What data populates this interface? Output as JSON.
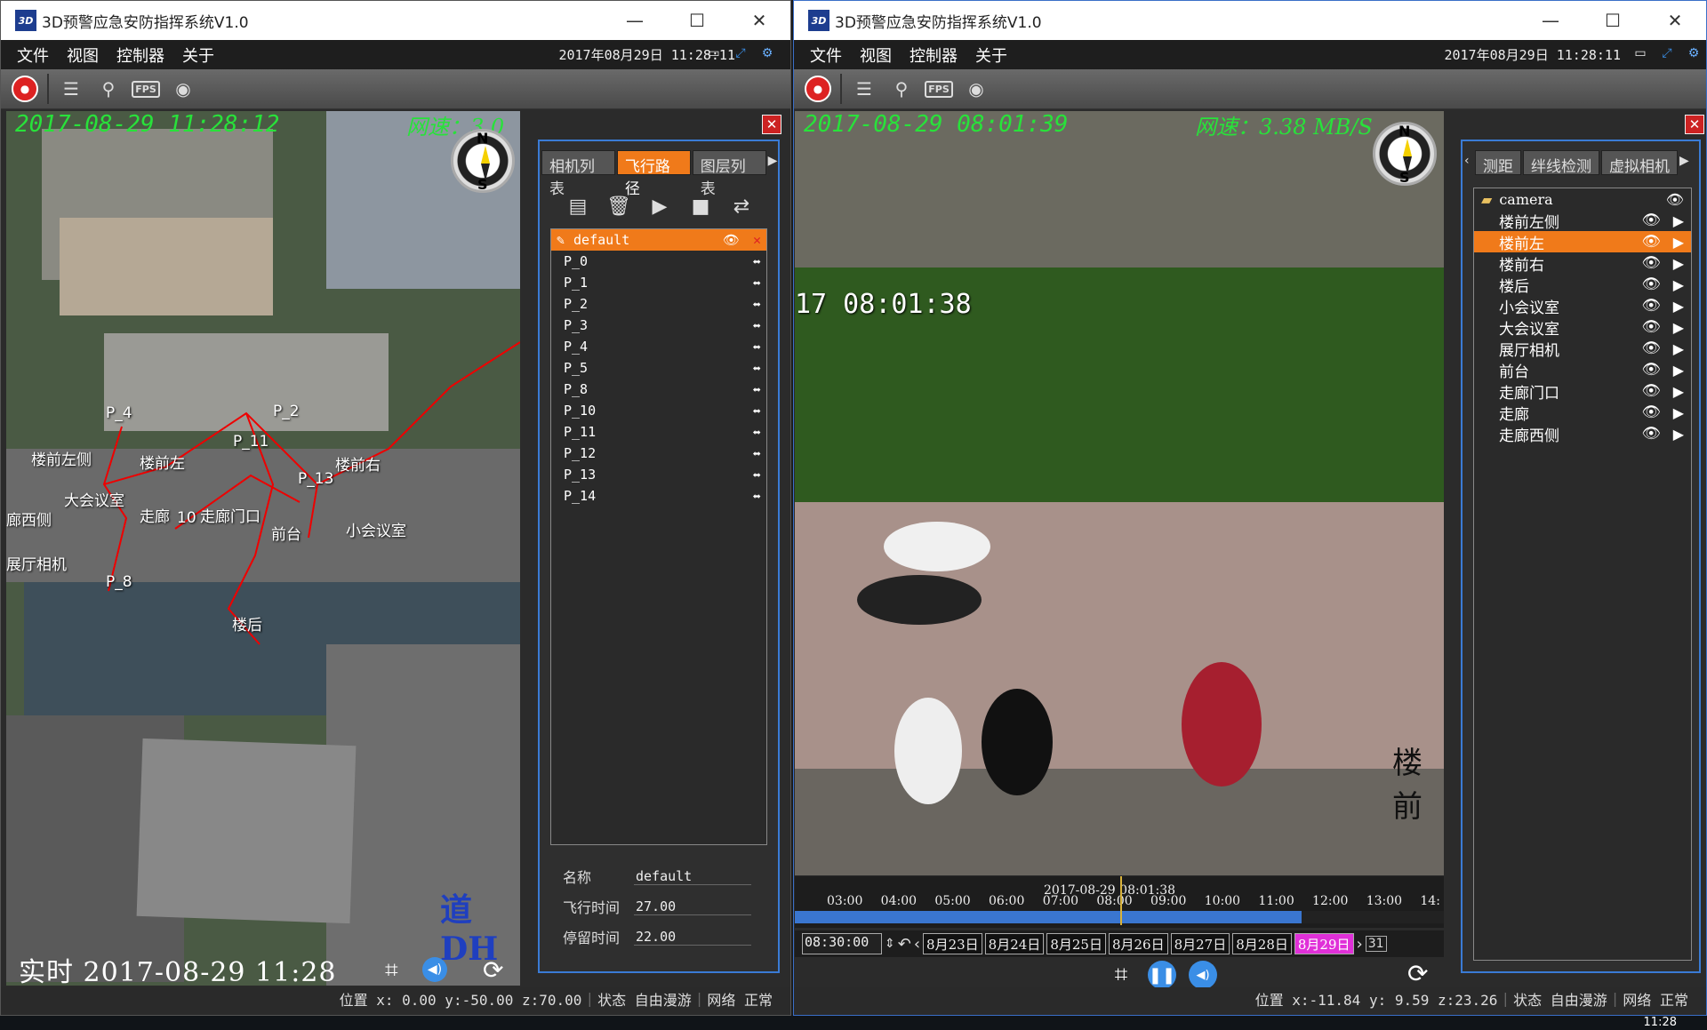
{
  "left_window": {
    "title": "3D预警应急安防指挥系统V1.0",
    "logo_text": "3D",
    "window_controls": {
      "minimize": "—",
      "maximize": "☐",
      "close": "✕"
    },
    "menu": [
      "文件",
      "视图",
      "控制器",
      "关于"
    ],
    "datetime": "2017年08月29日 11:28:11",
    "overlay_time": "2017-08-29 11:28:12",
    "overlay_speed": "网速：3.0",
    "compass": {
      "north": "N",
      "south": "S"
    },
    "map_labels": {
      "p4": "P_4",
      "p2": "P_2",
      "p11": "P_11",
      "p13": "P_13",
      "p8": "P_8",
      "p10": "10",
      "loqian_zuoce": "楼前左侧",
      "loqian_zuo": "楼前左",
      "loqian_you": "楼前右",
      "dahui": "大会议室",
      "zoulang": "走廊",
      "zoulang_menkou": "走廊门口",
      "qiantai": "前台",
      "xiaohui": "小会议室",
      "zhanting": "展厅相机",
      "langxi": "廊西侧",
      "louhou": "楼后"
    },
    "logo_watermark": "道DH",
    "bottom_overlay": "实时  2017-08-29 11:28",
    "tabs": [
      "相机列表",
      "飞行路径",
      "图层列表"
    ],
    "active_tab": "飞行路径",
    "path_list": {
      "selected": "default",
      "items": [
        "P_0",
        "P_1",
        "P_2",
        "P_3",
        "P_4",
        "P_5",
        "P_8",
        "P_10",
        "P_11",
        "P_12",
        "P_13",
        "P_14"
      ]
    },
    "props": [
      {
        "key": "名称",
        "value": "default"
      },
      {
        "key": "飞行时间",
        "value": "27.00"
      },
      {
        "key": "停留时间",
        "value": "22.00"
      }
    ],
    "status": {
      "position": "位置 x: 0.00 y:-50.00 z:70.00",
      "state": "状态  自由漫游",
      "network": "网络  正常"
    }
  },
  "right_window": {
    "title": "3D预警应急安防指挥系统V1.0",
    "logo_text": "3D",
    "window_controls": {
      "minimize": "—",
      "maximize": "☐",
      "close": "✕"
    },
    "menu": [
      "文件",
      "视图",
      "控制器",
      "关于"
    ],
    "datetime": "2017年08月29日 11:28:11",
    "overlay_time": "2017-08-29 08:01:39",
    "overlay_speed": "网速：3.38 MB/S",
    "compass": {
      "north": "N",
      "south": "S"
    },
    "video_osd": "17 08:01:38",
    "video_corner_text": "楼前",
    "timeline": {
      "timestamp": "2017-08-29 08:01:38",
      "ticks": [
        "03:00",
        "04:00",
        "05:00",
        "06:00",
        "07:00",
        "08:00",
        "09:00",
        "10:00",
        "11:00",
        "12:00",
        "13:00",
        "14:"
      ]
    },
    "time_input": "08:30:00",
    "dates": [
      "8月23日",
      "8月24日",
      "8月25日",
      "8月26日",
      "8月27日",
      "8月28日",
      "8月29日"
    ],
    "active_date": "8月29日",
    "tabs": [
      "测距",
      "绊线检测",
      "虚拟相机"
    ],
    "camera_tree": {
      "root": "camera",
      "selected": "楼前左",
      "items": [
        "楼前左侧",
        "楼前左",
        "楼前右",
        "楼后",
        "小会议室",
        "大会议室",
        "展厅相机",
        "前台",
        "走廊门口",
        "走廊",
        "走廊西侧"
      ]
    },
    "status": {
      "position": "位置 x:-11.84 y: 9.59 z:23.26",
      "state": "状态  自由漫游",
      "network": "网络  正常"
    }
  },
  "taskbar": {
    "clock": "11:28"
  },
  "colors": {
    "accent": "#f07a1a",
    "panel_border": "#3a7bd5",
    "overlay_green": "#28e23a",
    "date_active": "#e030d8"
  }
}
